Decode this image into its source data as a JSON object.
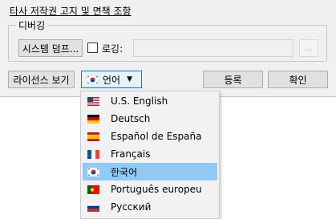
{
  "dialog": {
    "notice_link": "타사 저작권 고지 및 면책 조항",
    "debug_group": {
      "title": "디버깅",
      "dump_button": "시스템 덤프...",
      "logging_label": "로깅:",
      "logging_checked": false,
      "browse_button": "..."
    },
    "buttons": {
      "license": "라이선스 보기",
      "language": "언어",
      "register": "등록",
      "confirm": "확인"
    }
  },
  "language_menu": {
    "selected_index": 4,
    "items": [
      {
        "label": "U.S. English",
        "icon": "us-flag-icon"
      },
      {
        "label": "Deutsch",
        "icon": "german-flag-icon"
      },
      {
        "label": "Español de España",
        "icon": "spanish-flag-icon"
      },
      {
        "label": "Français",
        "icon": "french-flag-icon"
      },
      {
        "label": "한국어",
        "icon": "korean-flag-icon"
      },
      {
        "label": "Português europeu",
        "icon": "portuguese-flag-icon"
      },
      {
        "label": "Русский",
        "icon": "russian-flag-icon"
      }
    ]
  },
  "colors": {
    "dialog_bg": "#f0f0f0",
    "menu_bg": "#f2f2f2",
    "selection": "#91c9f7",
    "focus_border": "#0078d7"
  }
}
